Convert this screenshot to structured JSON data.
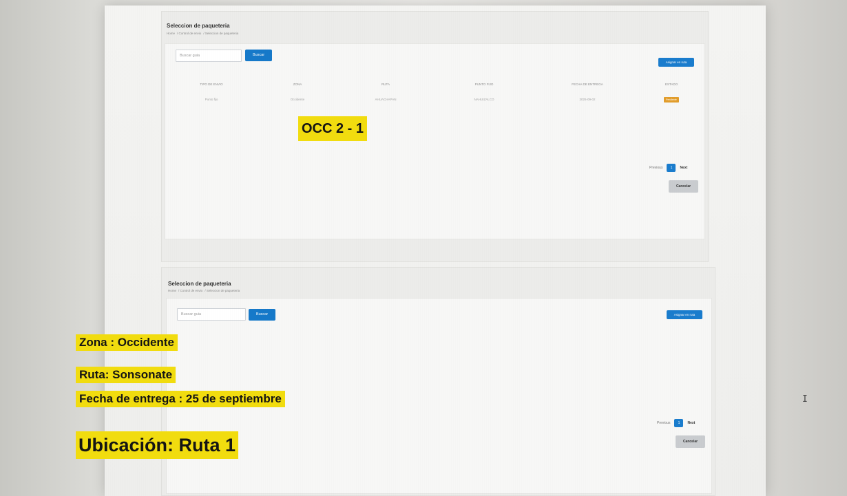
{
  "top_view": {
    "title": "Seleccion de paqueteria",
    "breadcrumb": [
      "Home",
      "Control de envio",
      "Seleccion de paqueteria"
    ],
    "search_placeholder": "Buscar guia",
    "search_button": "Buscar",
    "assign_button": "Asignar en ruta",
    "table": {
      "headers": [
        "TIPO DE ENVIO",
        "ZONA",
        "RUTA",
        "PUNTO FIJO",
        "FECHA DE ENTREGA",
        "ESTADO"
      ],
      "row": [
        "Punto fijo",
        "Occidente",
        "AHUACHAPAN",
        "NAHUIZALCO",
        "2025-09-02",
        "Pendiente"
      ]
    },
    "pagination": {
      "previous": "Previous",
      "page": "1",
      "next": "Next"
    },
    "cancel_button": "Cancelar",
    "highlight_label": "OCC 2 - 1"
  },
  "bottom_view": {
    "title": "Seleccion de paqueteria",
    "breadcrumb": [
      "Home",
      "Control de envio",
      "Seleccion de paqueteria"
    ],
    "search_placeholder": "Buscar guia",
    "search_button": "Buscar",
    "assign_button": "Asignar en ruta",
    "pagination": {
      "previous": "Previous",
      "page": "1",
      "next": "Next"
    },
    "cancel_button": "Cancelar",
    "annotations": {
      "zona": "Zona : Occidente",
      "ruta": "Ruta: Sonsonate",
      "fecha": "Fecha de entrega : 25 de septiembre",
      "ubicacion": "Ubicación: Ruta 1"
    }
  },
  "colors": {
    "primary": "#1679c9",
    "highlight": "#f1dc0f",
    "status_pending": "#e29d2b",
    "cancel": "#c9cccf"
  }
}
